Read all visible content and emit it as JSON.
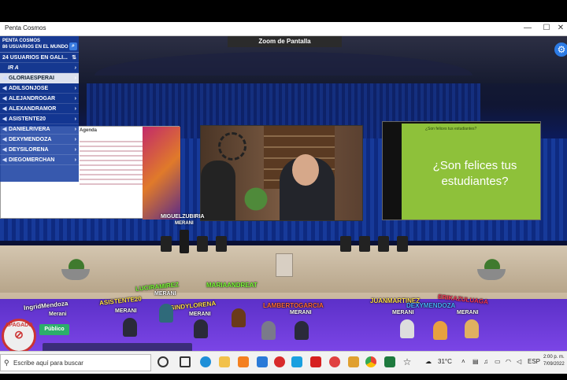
{
  "window": {
    "title": "Penta Cosmos",
    "minimize_glyph": "—",
    "maximize_glyph": "☐",
    "close_glyph": "✕"
  },
  "toolbar": {
    "zoom_label": "Zoom de Pantalla",
    "settings_icon": "gear-icon"
  },
  "sidebar": {
    "title": "PENTA COSMOS",
    "world_users": "86 USUARIOS EN EL MUNDO",
    "gallery_users": "24 USUARIOS EN GALI...",
    "goto_label": "IR A",
    "users": [
      "GLORIAESPERAI",
      "ADILSONJOSE",
      "ALEJANDROGAR",
      "ALEXANDRAMOR",
      "ASISTENTE20",
      "DANIELRIVERA",
      "DEXYMENDOZA",
      "DEYSILORENA",
      "DIEGOMERCHAN"
    ]
  },
  "screens": {
    "left_heading": "Agenda",
    "right_title_small": "¿Son felices tus estudiantes?",
    "right_title_big": "¿Son felices tus estudiantes?"
  },
  "stage_speaker": {
    "name": "MIGUELZUBIRIA",
    "group": "MERANI"
  },
  "audience": [
    {
      "name": "IngridMendoza",
      "group": "Merani"
    },
    {
      "name": "ASISTENTE20",
      "group": "MERANI"
    },
    {
      "name": "LUCIRAMIREZ",
      "group": "MERANI"
    },
    {
      "name": "SINDYLORENA",
      "group": "MERANI"
    },
    {
      "name": "MARIAANDREAT",
      "group": ""
    },
    {
      "name": "LAMBERTOGARCIA",
      "group": "MERANI"
    },
    {
      "name": "JUANMARTINEZ",
      "group": "MERANI"
    },
    {
      "name": "DEXYMENDOZA",
      "group": "MERANI"
    },
    {
      "name": "ERIKAZULUAGA",
      "group": ""
    }
  ],
  "controls": {
    "mic_status": "APAGADO",
    "channel": "Público"
  },
  "taskbar": {
    "search_placeholder": "Escribe aquí para buscar",
    "temperature": "31°C",
    "language": "ESP",
    "time": "2:00 p. m.",
    "date": "7/09/2022"
  }
}
